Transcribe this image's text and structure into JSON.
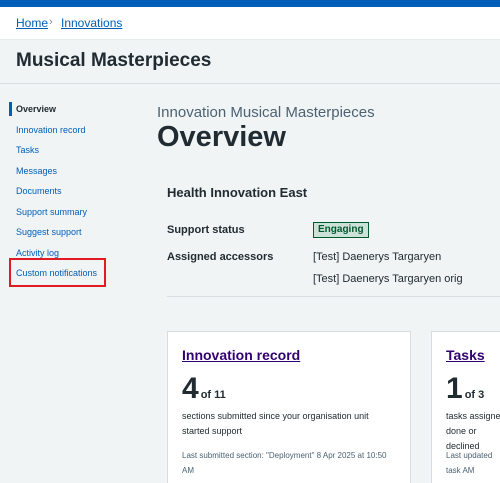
{
  "breadcrumb": {
    "home": "Home",
    "separator": "›",
    "current": "Innovations"
  },
  "page_title": "Musical Masterpieces",
  "sidebar": {
    "items": [
      {
        "label": "Overview",
        "active": true
      },
      {
        "label": "Innovation record"
      },
      {
        "label": "Tasks"
      },
      {
        "label": "Messages"
      },
      {
        "label": "Documents"
      },
      {
        "label": "Support summary"
      },
      {
        "label": "Suggest support"
      },
      {
        "label": "Activity log"
      },
      {
        "label": "Custom notifications",
        "highlighted": true
      }
    ]
  },
  "main": {
    "subtitle": "Innovation Musical Masterpieces",
    "title": "Overview",
    "organisation": "Health Innovation East",
    "support_status_label": "Support status",
    "support_status_tag": "Engaging",
    "assigned_accessors_label": "Assigned accessors",
    "accessors": [
      "[Test] Daenerys Targaryen",
      "[Test] Daenerys Targaryen orig"
    ]
  },
  "cards": [
    {
      "title": "Innovation record",
      "number": "4",
      "of": "of 11",
      "description": "sections submitted since your organisation unit started support",
      "meta": "Last submitted section: \"Deployment\" 8 Apr 2025 at 10:50 AM"
    },
    {
      "title": "Tasks",
      "number": "1",
      "of": "of 3",
      "description": "tasks assigned done or declined",
      "meta": "Last updated task AM"
    }
  ],
  "colors": {
    "brand_blue": "#005eb8",
    "page_background": "#f0f4f5",
    "visited_link": "#330072",
    "tag_green": "#005a30",
    "highlight_red": "#e01b22"
  }
}
